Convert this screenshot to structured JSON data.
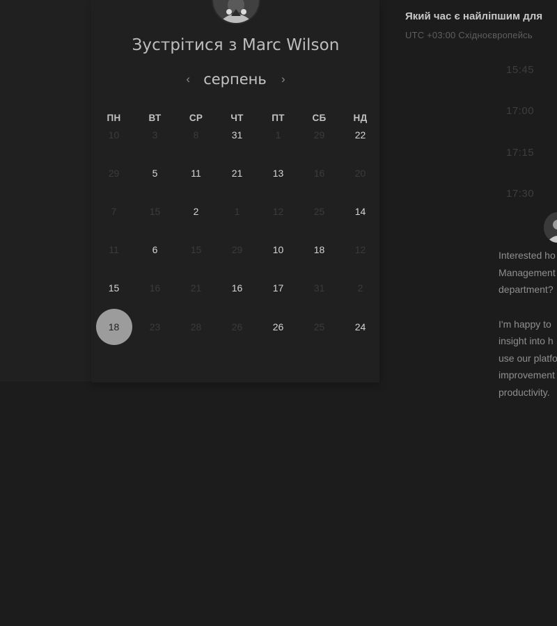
{
  "scheduler": {
    "title": "Зустрітися з Marc Wilson",
    "month": "серпень",
    "weekdays": [
      "ПН",
      "ВТ",
      "СР",
      "ЧТ",
      "ПТ",
      "СБ",
      "НД"
    ],
    "selected_day": "18",
    "weeks": [
      [
        {
          "d": "10",
          "a": false
        },
        {
          "d": "3",
          "a": false
        },
        {
          "d": "8",
          "a": false
        },
        {
          "d": "31",
          "a": true
        },
        {
          "d": "1",
          "a": false
        },
        {
          "d": "29",
          "a": false
        },
        {
          "d": "22",
          "a": true
        }
      ],
      [
        {
          "d": "29",
          "a": false
        },
        {
          "d": "5",
          "a": true
        },
        {
          "d": "11",
          "a": true
        },
        {
          "d": "21",
          "a": true
        },
        {
          "d": "13",
          "a": true
        },
        {
          "d": "16",
          "a": false
        },
        {
          "d": "20",
          "a": false
        }
      ],
      [
        {
          "d": "7",
          "a": false
        },
        {
          "d": "15",
          "a": false
        },
        {
          "d": "2",
          "a": true
        },
        {
          "d": "1",
          "a": false
        },
        {
          "d": "12",
          "a": false
        },
        {
          "d": "25",
          "a": false
        },
        {
          "d": "14",
          "a": true
        }
      ],
      [
        {
          "d": "11",
          "a": false
        },
        {
          "d": "6",
          "a": true
        },
        {
          "d": "15",
          "a": false
        },
        {
          "d": "29",
          "a": false
        },
        {
          "d": "10",
          "a": true
        },
        {
          "d": "18",
          "a": true
        },
        {
          "d": "12",
          "a": false
        }
      ],
      [
        {
          "d": "15",
          "a": true
        },
        {
          "d": "16",
          "a": false
        },
        {
          "d": "21",
          "a": false
        },
        {
          "d": "16",
          "a": true
        },
        {
          "d": "17",
          "a": true
        },
        {
          "d": "31",
          "a": false
        },
        {
          "d": "2",
          "a": false
        }
      ],
      [
        {
          "d": "18",
          "a": true,
          "selected": true
        },
        {
          "d": "23",
          "a": false
        },
        {
          "d": "28",
          "a": false
        },
        {
          "d": "26",
          "a": false
        },
        {
          "d": "26",
          "a": true
        },
        {
          "d": "25",
          "a": false
        },
        {
          "d": "24",
          "a": true
        }
      ]
    ]
  },
  "times": {
    "question": "Який час є найліпшим для",
    "timezone": "UTC +03:00 Східноєвропейсь",
    "slots": [
      "15:45",
      "17:00",
      "17:15",
      "17:30"
    ]
  },
  "message": {
    "lines": [
      "Interested ho",
      "Management",
      "department?",
      "",
      "I'm happy to",
      "insight into h",
      "use our platfo",
      "improvement",
      "productivity."
    ]
  },
  "colors": {
    "background": "#1c1c1d",
    "panel": "#202021",
    "selected": "#9c9c9c"
  }
}
